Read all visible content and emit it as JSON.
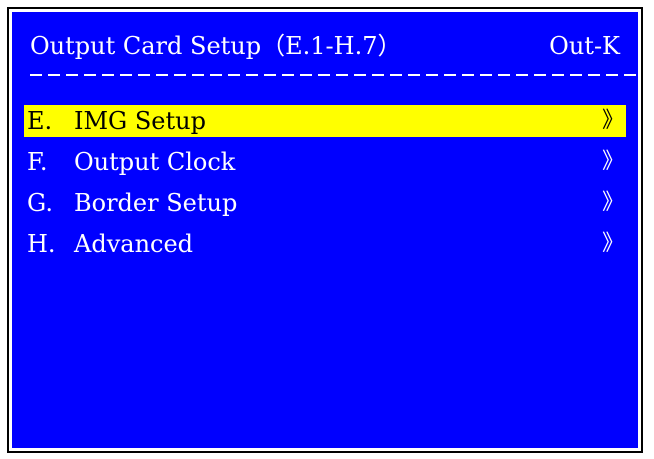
{
  "header": {
    "title": "Output Card Setup（E.1-H.7）",
    "mode": "Out-K"
  },
  "menu": {
    "items": [
      {
        "key": "E.",
        "label": "IMG Setup",
        "arrow": "》",
        "selected": true
      },
      {
        "key": "F.",
        "label": "Output Clock",
        "arrow": "》",
        "selected": false
      },
      {
        "key": "G.",
        "label": "Border Setup",
        "arrow": "》",
        "selected": false
      },
      {
        "key": "H.",
        "label": "Advanced",
        "arrow": "》",
        "selected": false
      }
    ]
  },
  "colors": {
    "background": "#0000ff",
    "text": "#ffffff",
    "highlight": "#ffff00",
    "highlight_text": "#000000"
  }
}
